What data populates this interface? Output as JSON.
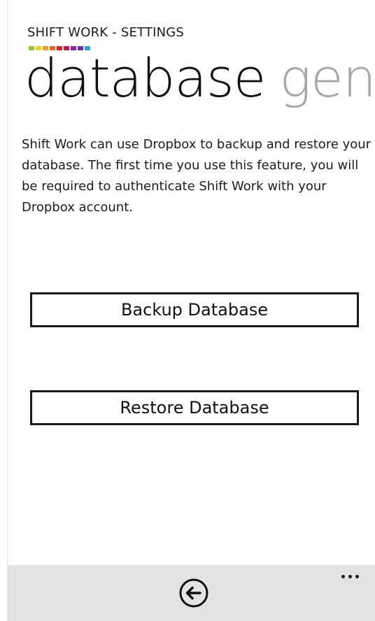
{
  "header": {
    "app_title": "SHIFT WORK - SETTINGS",
    "accent_colors": [
      "#8cc63f",
      "#f7d21f",
      "#f59a23",
      "#f26522",
      "#e0202b",
      "#c2185b",
      "#8e24aa",
      "#5e35b1",
      "#29a3e0"
    ]
  },
  "pivot": {
    "active": "database",
    "next": "gene"
  },
  "content": {
    "description": "Shift Work can use Dropbox to backup and restore your database. The first time you use this feature, you will be required to authenticate Shift Work with your Dropbox account."
  },
  "buttons": {
    "backup": "Backup Database",
    "restore": "Restore Database"
  },
  "appbar": {
    "back_icon": "back-arrow-circle-icon",
    "more_icon": "ellipsis-icon"
  }
}
